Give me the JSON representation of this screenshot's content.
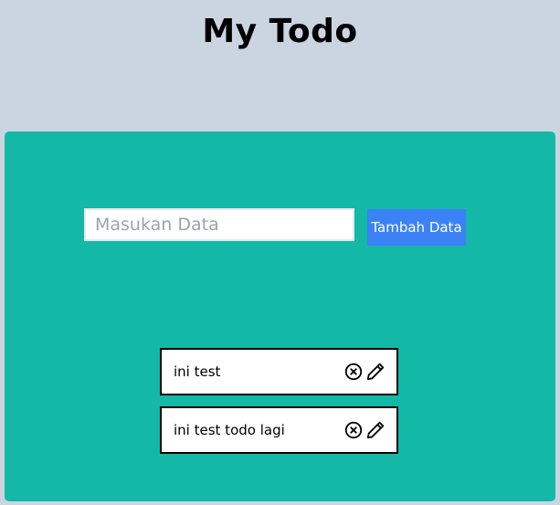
{
  "header": {
    "title": "My Todo"
  },
  "form": {
    "placeholder": "Masukan Data",
    "value": "",
    "add_button_label": "Tambah Data"
  },
  "todos": [
    {
      "text": "ini test",
      "delete_icon": "x-circle-icon",
      "edit_icon": "pencil-icon"
    },
    {
      "text": "ini test todo lagi",
      "delete_icon": "x-circle-icon",
      "edit_icon": "pencil-icon"
    }
  ],
  "colors": {
    "background": "#cbd5e1",
    "panel": "#14b8a6",
    "button": "#3b82f6",
    "item_border": "#000000"
  }
}
